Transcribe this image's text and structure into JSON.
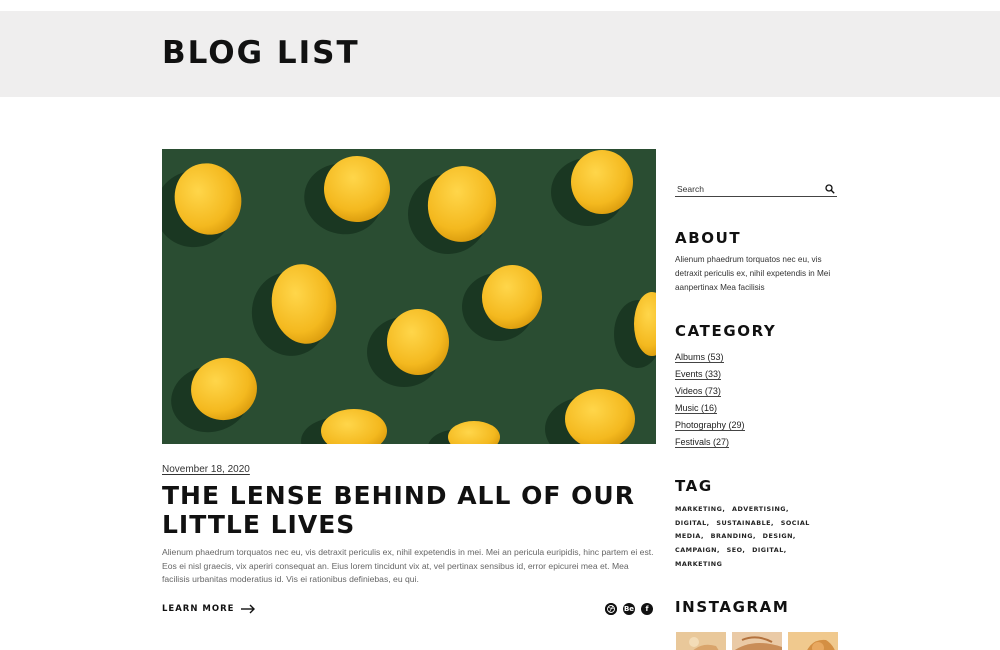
{
  "header": {
    "title": "BLOG LIST"
  },
  "post": {
    "date": "November 18, 2020",
    "title": "THE LENSE BEHIND ALL OF OUR LITTLE LIVES",
    "excerpt": "Alienum phaedrum torquatos nec eu, vis detraxit periculis ex, nihil expetendis in mei. Mei an pericula euripidis, hinc partem ei est. Eos ei nisl graecis, vix aperiri consequat an. Eius lorem tincidunt vix at, vel pertinax sensibus id, error epicurei mea et. Mea facilisis urbanitas moderatius id. Vis ei rationibus definiebas, eu qui.",
    "learn_more": "LEARN MORE",
    "image_icon": "lemons-photo",
    "social_icons": [
      "dribbble-icon",
      "behance-icon",
      "facebook-icon"
    ]
  },
  "sidebar": {
    "search": {
      "placeholder": "Search",
      "icon": "search-icon"
    },
    "about": {
      "heading": "ABOUT",
      "text": "Alienum phaedrum torquatos nec eu, vis detraxit periculis ex, nihil expetendis in Mei aanpertinax Mea facilisis"
    },
    "category": {
      "heading": "CATEGORY",
      "items": [
        {
          "label": "Albums (53)"
        },
        {
          "label": "Events  (33)"
        },
        {
          "label": "Videos (73)"
        },
        {
          "label": "Music (16)"
        },
        {
          "label": "Photography (29)"
        },
        {
          "label": "Festivals (27)"
        }
      ]
    },
    "tag": {
      "heading": "TAG",
      "items": [
        "MARKETING,",
        "ADVERTISING,",
        "DIGITAL,",
        "SUSTAINABLE,",
        "SOCIAL MEDIA,",
        "BRANDING,",
        "DESIGN,",
        "CAMPAIGN,",
        "SEO,",
        "DIGITAL,",
        "MARKETING"
      ]
    },
    "instagram": {
      "heading": "INSTAGRAM"
    }
  },
  "colors": {
    "header_bg": "#efeeee",
    "image_bg": "#2a4d32",
    "lemon": "#f4b91f",
    "text": "#111111"
  }
}
